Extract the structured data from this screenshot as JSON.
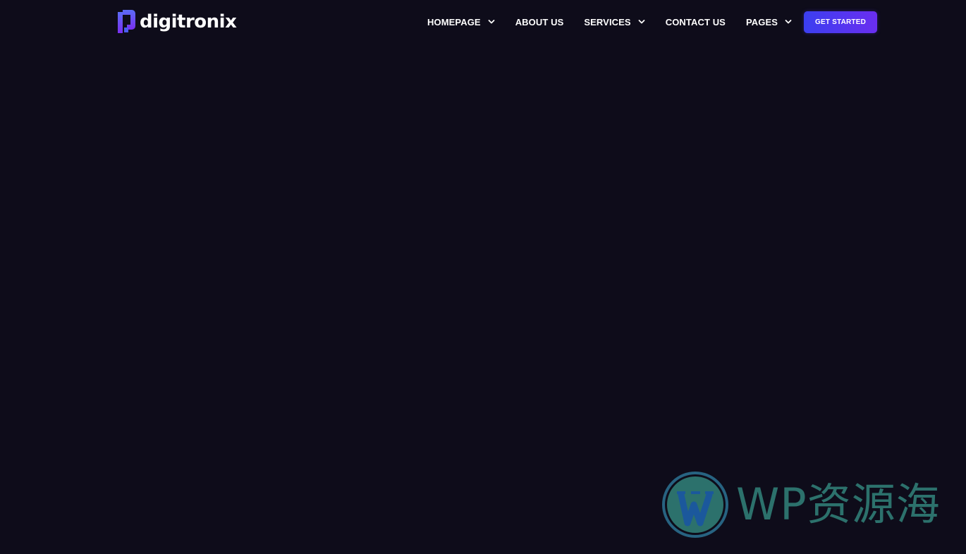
{
  "brand": {
    "name": "digitronix",
    "mark_color_top": "#5b6cf5",
    "mark_color_bottom": "#7a2ff0"
  },
  "nav": {
    "items": [
      {
        "label": "HOMEPAGE",
        "has_dropdown": true
      },
      {
        "label": "ABOUT US",
        "has_dropdown": false
      },
      {
        "label": "SERVICES",
        "has_dropdown": true
      },
      {
        "label": "CONTACT US",
        "has_dropdown": false
      },
      {
        "label": "PAGES",
        "has_dropdown": true
      }
    ],
    "cta_label": "GET STARTED",
    "cta_color_start": "#3b3ff0",
    "cta_color_end": "#6a2ef0"
  },
  "watermark": {
    "text": "WP资源海",
    "icon": "wordpress-icon",
    "color": "#2f7a73"
  },
  "theme": {
    "background": "#0e0c1a",
    "text": "#ffffff"
  }
}
